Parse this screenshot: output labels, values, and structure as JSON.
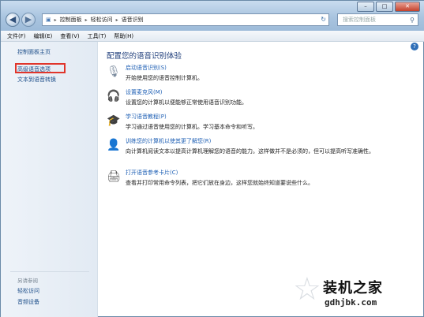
{
  "address": {
    "segments": [
      "控制面板",
      "轻松访问",
      "语音识别"
    ],
    "search_placeholder": "搜索控制面板"
  },
  "menu": [
    "文件(F)",
    "编辑(E)",
    "查看(V)",
    "工具(T)",
    "帮助(H)"
  ],
  "sidebar": {
    "home": "控制面板主页",
    "links": [
      "高级语音选项",
      "文本到语音转换"
    ],
    "see_also_label": "另请参阅",
    "see_also": [
      "轻松访问",
      "音频设备"
    ]
  },
  "main": {
    "heading": "配置您的语音识别体验",
    "items": [
      {
        "icon": "microphone-icon",
        "title": "启动语音识别(S)",
        "desc": "开始使用您的语音控制计算机。"
      },
      {
        "icon": "headset-icon",
        "title": "设置麦克风(M)",
        "desc": "设置您的计算机以便能够正常使用语音识别功能。"
      },
      {
        "icon": "graduation-cap-icon",
        "title": "学习语音教程(P)",
        "desc": "学习通过语音使用您的计算机。学习基本命令和听写。"
      },
      {
        "icon": "training-icon",
        "title": "训练您的计算机以使其更了解您(R)",
        "desc": "向计算机阅读文本以提高计算机理解您的语音的能力。这样做并不是必须的，但可以提高听写准确性。"
      },
      {
        "icon": "printer-icon",
        "title": "打开语音参考卡片(C)",
        "desc": "查看并打印常用命令列表，把它们放在身边，这样您就始终知道要说些什么。"
      }
    ]
  },
  "watermark": {
    "name": "装机之家",
    "url": "gdhjbk.com"
  }
}
